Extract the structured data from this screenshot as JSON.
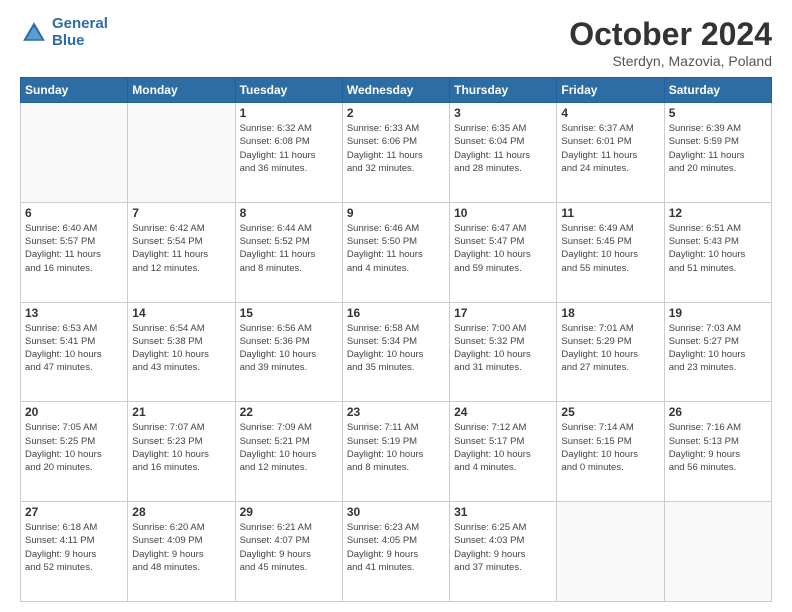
{
  "logo": {
    "line1": "General",
    "line2": "Blue"
  },
  "title": "October 2024",
  "subtitle": "Sterdyn, Mazovia, Poland",
  "weekdays": [
    "Sunday",
    "Monday",
    "Tuesday",
    "Wednesday",
    "Thursday",
    "Friday",
    "Saturday"
  ],
  "weeks": [
    [
      {
        "day": "",
        "detail": ""
      },
      {
        "day": "",
        "detail": ""
      },
      {
        "day": "1",
        "detail": "Sunrise: 6:32 AM\nSunset: 6:08 PM\nDaylight: 11 hours\nand 36 minutes."
      },
      {
        "day": "2",
        "detail": "Sunrise: 6:33 AM\nSunset: 6:06 PM\nDaylight: 11 hours\nand 32 minutes."
      },
      {
        "day": "3",
        "detail": "Sunrise: 6:35 AM\nSunset: 6:04 PM\nDaylight: 11 hours\nand 28 minutes."
      },
      {
        "day": "4",
        "detail": "Sunrise: 6:37 AM\nSunset: 6:01 PM\nDaylight: 11 hours\nand 24 minutes."
      },
      {
        "day": "5",
        "detail": "Sunrise: 6:39 AM\nSunset: 5:59 PM\nDaylight: 11 hours\nand 20 minutes."
      }
    ],
    [
      {
        "day": "6",
        "detail": "Sunrise: 6:40 AM\nSunset: 5:57 PM\nDaylight: 11 hours\nand 16 minutes."
      },
      {
        "day": "7",
        "detail": "Sunrise: 6:42 AM\nSunset: 5:54 PM\nDaylight: 11 hours\nand 12 minutes."
      },
      {
        "day": "8",
        "detail": "Sunrise: 6:44 AM\nSunset: 5:52 PM\nDaylight: 11 hours\nand 8 minutes."
      },
      {
        "day": "9",
        "detail": "Sunrise: 6:46 AM\nSunset: 5:50 PM\nDaylight: 11 hours\nand 4 minutes."
      },
      {
        "day": "10",
        "detail": "Sunrise: 6:47 AM\nSunset: 5:47 PM\nDaylight: 10 hours\nand 59 minutes."
      },
      {
        "day": "11",
        "detail": "Sunrise: 6:49 AM\nSunset: 5:45 PM\nDaylight: 10 hours\nand 55 minutes."
      },
      {
        "day": "12",
        "detail": "Sunrise: 6:51 AM\nSunset: 5:43 PM\nDaylight: 10 hours\nand 51 minutes."
      }
    ],
    [
      {
        "day": "13",
        "detail": "Sunrise: 6:53 AM\nSunset: 5:41 PM\nDaylight: 10 hours\nand 47 minutes."
      },
      {
        "day": "14",
        "detail": "Sunrise: 6:54 AM\nSunset: 5:38 PM\nDaylight: 10 hours\nand 43 minutes."
      },
      {
        "day": "15",
        "detail": "Sunrise: 6:56 AM\nSunset: 5:36 PM\nDaylight: 10 hours\nand 39 minutes."
      },
      {
        "day": "16",
        "detail": "Sunrise: 6:58 AM\nSunset: 5:34 PM\nDaylight: 10 hours\nand 35 minutes."
      },
      {
        "day": "17",
        "detail": "Sunrise: 7:00 AM\nSunset: 5:32 PM\nDaylight: 10 hours\nand 31 minutes."
      },
      {
        "day": "18",
        "detail": "Sunrise: 7:01 AM\nSunset: 5:29 PM\nDaylight: 10 hours\nand 27 minutes."
      },
      {
        "day": "19",
        "detail": "Sunrise: 7:03 AM\nSunset: 5:27 PM\nDaylight: 10 hours\nand 23 minutes."
      }
    ],
    [
      {
        "day": "20",
        "detail": "Sunrise: 7:05 AM\nSunset: 5:25 PM\nDaylight: 10 hours\nand 20 minutes."
      },
      {
        "day": "21",
        "detail": "Sunrise: 7:07 AM\nSunset: 5:23 PM\nDaylight: 10 hours\nand 16 minutes."
      },
      {
        "day": "22",
        "detail": "Sunrise: 7:09 AM\nSunset: 5:21 PM\nDaylight: 10 hours\nand 12 minutes."
      },
      {
        "day": "23",
        "detail": "Sunrise: 7:11 AM\nSunset: 5:19 PM\nDaylight: 10 hours\nand 8 minutes."
      },
      {
        "day": "24",
        "detail": "Sunrise: 7:12 AM\nSunset: 5:17 PM\nDaylight: 10 hours\nand 4 minutes."
      },
      {
        "day": "25",
        "detail": "Sunrise: 7:14 AM\nSunset: 5:15 PM\nDaylight: 10 hours\nand 0 minutes."
      },
      {
        "day": "26",
        "detail": "Sunrise: 7:16 AM\nSunset: 5:13 PM\nDaylight: 9 hours\nand 56 minutes."
      }
    ],
    [
      {
        "day": "27",
        "detail": "Sunrise: 6:18 AM\nSunset: 4:11 PM\nDaylight: 9 hours\nand 52 minutes."
      },
      {
        "day": "28",
        "detail": "Sunrise: 6:20 AM\nSunset: 4:09 PM\nDaylight: 9 hours\nand 48 minutes."
      },
      {
        "day": "29",
        "detail": "Sunrise: 6:21 AM\nSunset: 4:07 PM\nDaylight: 9 hours\nand 45 minutes."
      },
      {
        "day": "30",
        "detail": "Sunrise: 6:23 AM\nSunset: 4:05 PM\nDaylight: 9 hours\nand 41 minutes."
      },
      {
        "day": "31",
        "detail": "Sunrise: 6:25 AM\nSunset: 4:03 PM\nDaylight: 9 hours\nand 37 minutes."
      },
      {
        "day": "",
        "detail": ""
      },
      {
        "day": "",
        "detail": ""
      }
    ]
  ]
}
